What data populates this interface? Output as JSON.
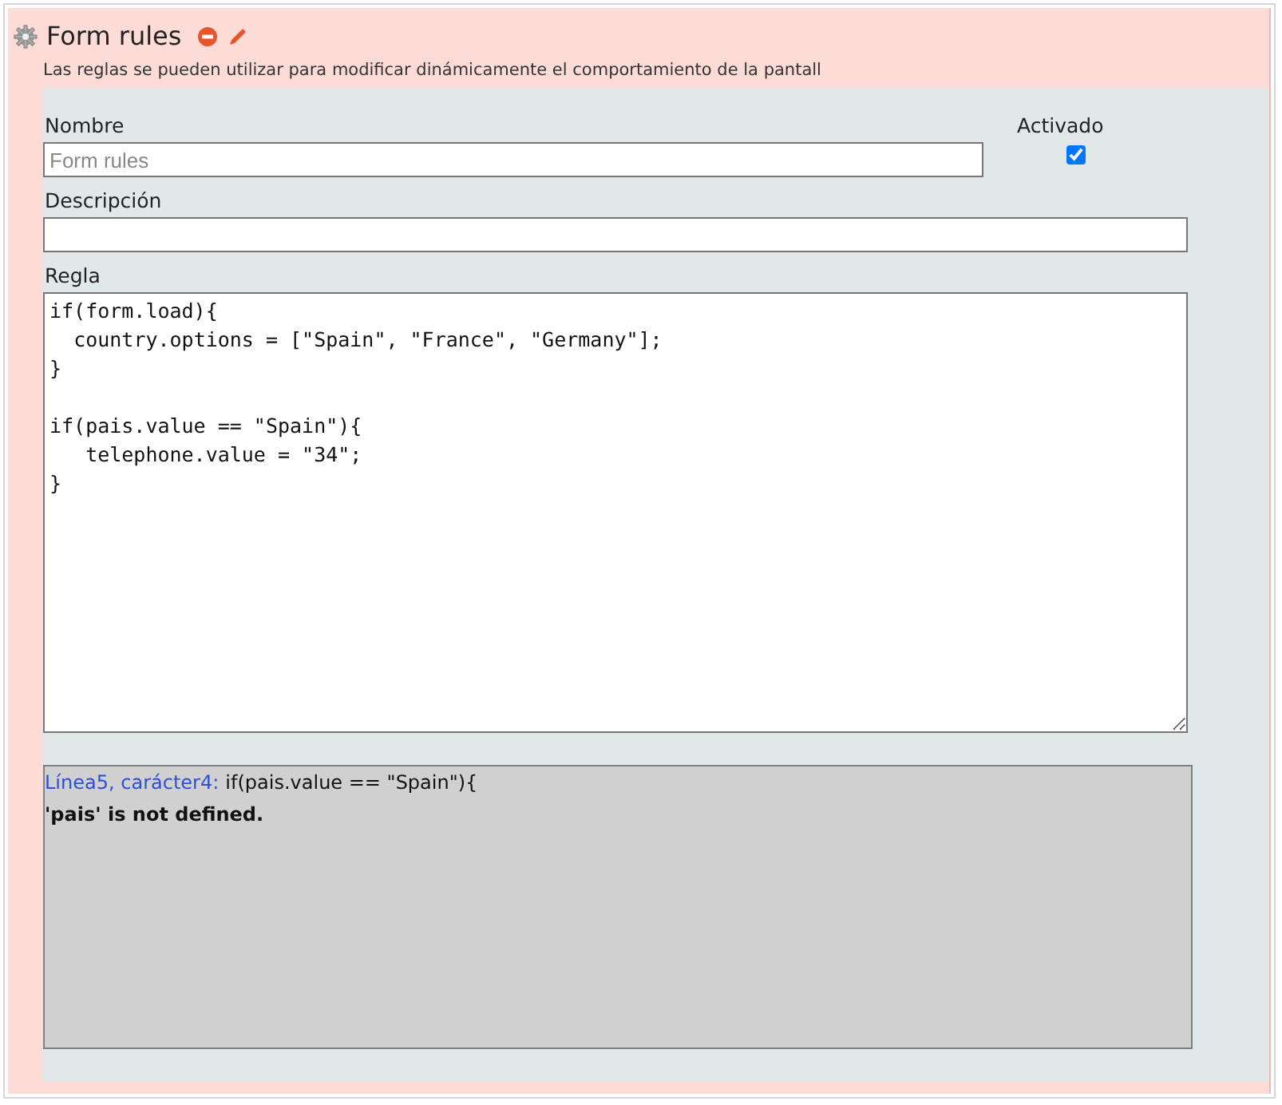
{
  "header": {
    "title": "Form rules",
    "description": "Las reglas se pueden utilizar para modificar dinámicamente el comportamiento de la pantall"
  },
  "form": {
    "name": {
      "label": "Nombre",
      "placeholder": "Form rules"
    },
    "enabled": {
      "label": "Activado",
      "checked": true
    },
    "description": {
      "label": "Descripción"
    },
    "rule": {
      "label": "Regla",
      "value": "if(form.load){\n  country.options = [\"Spain\", \"France\", \"Germany\"];\n}\n\nif(pais.value == \"Spain\"){\n   telephone.value = \"34\";\n}"
    }
  },
  "error": {
    "location": "Línea5, carácter4:",
    "source": "if(pais.value == \"Spain\"){",
    "message": "'pais' is not defined."
  }
}
